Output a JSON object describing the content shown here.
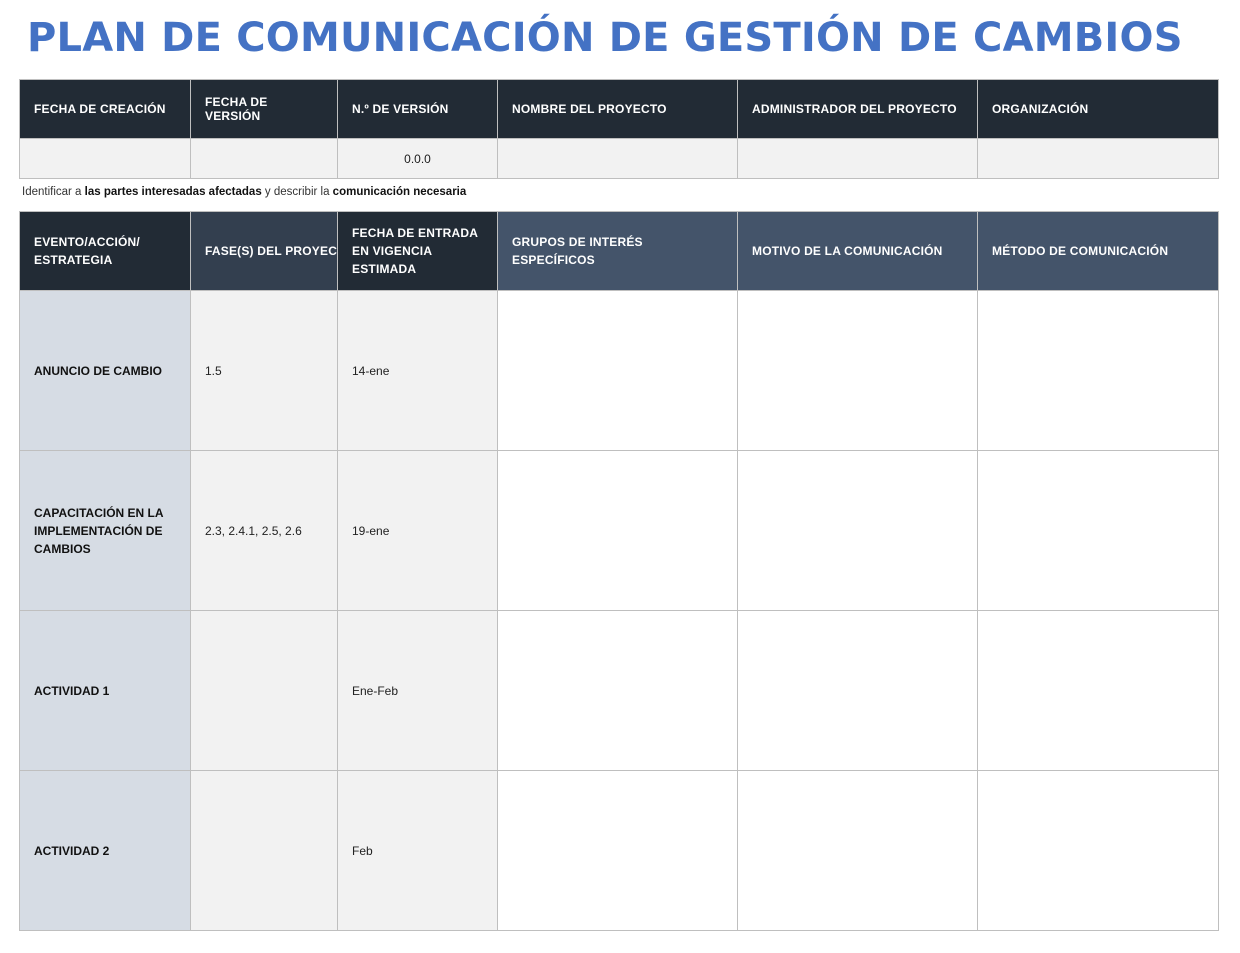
{
  "title": "PLAN DE COMUNICACIÓN DE GESTIÓN DE CAMBIOS",
  "colors": {
    "title": "#4472c4",
    "header_dark": "#222b35",
    "header_slate": "#44546a",
    "event_cell": "#d6dce4",
    "grey_cell": "#f2f2f2"
  },
  "meta": {
    "headers": [
      "FECHA DE CREACIÓN",
      "FECHA DE VERSIÓN",
      "N.º DE VERSIÓN",
      "NOMBRE DEL PROYECTO",
      "ADMINISTRADOR DEL PROYECTO",
      "ORGANIZACIÓN"
    ],
    "values": [
      "",
      "",
      "0.0.0",
      "",
      "",
      ""
    ]
  },
  "instruction": {
    "part1": "Identificar a ",
    "bold1": "las partes interesadas afectadas",
    "part2": " y describir la ",
    "bold2": "comunicación necesaria"
  },
  "main": {
    "headers": [
      "EVENTO/ACCIÓN/ ESTRATEGIA",
      "FASE(S) DEL PROYECTO",
      "FECHA DE ENTRADA EN VIGENCIA ESTIMADA",
      "GRUPOS DE INTERÉS ESPECÍFICOS",
      "MOTIVO DE LA COMUNICACIÓN",
      "MÉTODO DE COMUNICACIÓN"
    ],
    "rows": [
      {
        "event": "ANUNCIO DE CAMBIO",
        "phase": "1.5",
        "date": "14-ene",
        "groups": "",
        "reason": "",
        "method": ""
      },
      {
        "event": "CAPACITACIÓN EN LA IMPLEMENTACIÓN DE CAMBIOS",
        "phase": "2.3, 2.4.1, 2.5, 2.6",
        "date": "19-ene",
        "groups": "",
        "reason": "",
        "method": ""
      },
      {
        "event": "ACTIVIDAD 1",
        "phase": "",
        "date": "Ene-Feb",
        "groups": "",
        "reason": "",
        "method": ""
      },
      {
        "event": "ACTIVIDAD 2",
        "phase": "",
        "date": "Feb",
        "groups": "",
        "reason": "",
        "method": ""
      }
    ]
  }
}
